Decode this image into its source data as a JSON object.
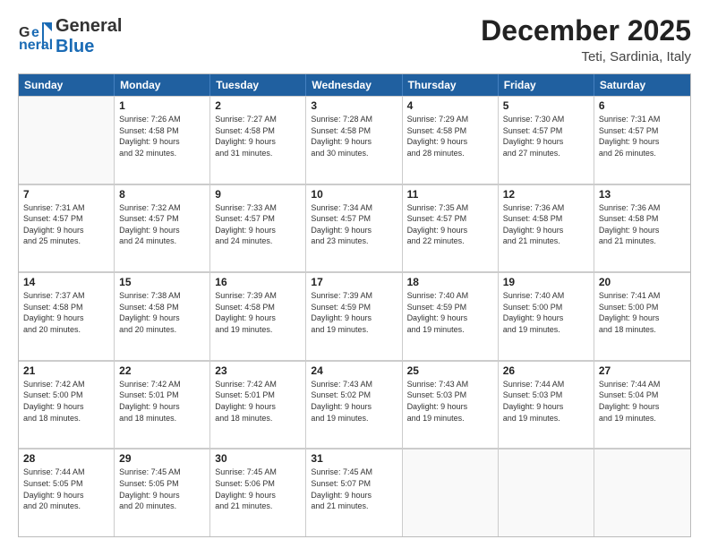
{
  "header": {
    "logo": "GeneralBlue",
    "title": "December 2025",
    "location": "Teti, Sardinia, Italy"
  },
  "days_of_week": [
    "Sunday",
    "Monday",
    "Tuesday",
    "Wednesday",
    "Thursday",
    "Friday",
    "Saturday"
  ],
  "weeks": [
    [
      {
        "day": "",
        "info": ""
      },
      {
        "day": "1",
        "info": "Sunrise: 7:26 AM\nSunset: 4:58 PM\nDaylight: 9 hours\nand 32 minutes."
      },
      {
        "day": "2",
        "info": "Sunrise: 7:27 AM\nSunset: 4:58 PM\nDaylight: 9 hours\nand 31 minutes."
      },
      {
        "day": "3",
        "info": "Sunrise: 7:28 AM\nSunset: 4:58 PM\nDaylight: 9 hours\nand 30 minutes."
      },
      {
        "day": "4",
        "info": "Sunrise: 7:29 AM\nSunset: 4:58 PM\nDaylight: 9 hours\nand 28 minutes."
      },
      {
        "day": "5",
        "info": "Sunrise: 7:30 AM\nSunset: 4:57 PM\nDaylight: 9 hours\nand 27 minutes."
      },
      {
        "day": "6",
        "info": "Sunrise: 7:31 AM\nSunset: 4:57 PM\nDaylight: 9 hours\nand 26 minutes."
      }
    ],
    [
      {
        "day": "7",
        "info": "Sunrise: 7:31 AM\nSunset: 4:57 PM\nDaylight: 9 hours\nand 25 minutes."
      },
      {
        "day": "8",
        "info": "Sunrise: 7:32 AM\nSunset: 4:57 PM\nDaylight: 9 hours\nand 24 minutes."
      },
      {
        "day": "9",
        "info": "Sunrise: 7:33 AM\nSunset: 4:57 PM\nDaylight: 9 hours\nand 24 minutes."
      },
      {
        "day": "10",
        "info": "Sunrise: 7:34 AM\nSunset: 4:57 PM\nDaylight: 9 hours\nand 23 minutes."
      },
      {
        "day": "11",
        "info": "Sunrise: 7:35 AM\nSunset: 4:57 PM\nDaylight: 9 hours\nand 22 minutes."
      },
      {
        "day": "12",
        "info": "Sunrise: 7:36 AM\nSunset: 4:58 PM\nDaylight: 9 hours\nand 21 minutes."
      },
      {
        "day": "13",
        "info": "Sunrise: 7:36 AM\nSunset: 4:58 PM\nDaylight: 9 hours\nand 21 minutes."
      }
    ],
    [
      {
        "day": "14",
        "info": "Sunrise: 7:37 AM\nSunset: 4:58 PM\nDaylight: 9 hours\nand 20 minutes."
      },
      {
        "day": "15",
        "info": "Sunrise: 7:38 AM\nSunset: 4:58 PM\nDaylight: 9 hours\nand 20 minutes."
      },
      {
        "day": "16",
        "info": "Sunrise: 7:39 AM\nSunset: 4:58 PM\nDaylight: 9 hours\nand 19 minutes."
      },
      {
        "day": "17",
        "info": "Sunrise: 7:39 AM\nSunset: 4:59 PM\nDaylight: 9 hours\nand 19 minutes."
      },
      {
        "day": "18",
        "info": "Sunrise: 7:40 AM\nSunset: 4:59 PM\nDaylight: 9 hours\nand 19 minutes."
      },
      {
        "day": "19",
        "info": "Sunrise: 7:40 AM\nSunset: 5:00 PM\nDaylight: 9 hours\nand 19 minutes."
      },
      {
        "day": "20",
        "info": "Sunrise: 7:41 AM\nSunset: 5:00 PM\nDaylight: 9 hours\nand 18 minutes."
      }
    ],
    [
      {
        "day": "21",
        "info": "Sunrise: 7:42 AM\nSunset: 5:00 PM\nDaylight: 9 hours\nand 18 minutes."
      },
      {
        "day": "22",
        "info": "Sunrise: 7:42 AM\nSunset: 5:01 PM\nDaylight: 9 hours\nand 18 minutes."
      },
      {
        "day": "23",
        "info": "Sunrise: 7:42 AM\nSunset: 5:01 PM\nDaylight: 9 hours\nand 18 minutes."
      },
      {
        "day": "24",
        "info": "Sunrise: 7:43 AM\nSunset: 5:02 PM\nDaylight: 9 hours\nand 19 minutes."
      },
      {
        "day": "25",
        "info": "Sunrise: 7:43 AM\nSunset: 5:03 PM\nDaylight: 9 hours\nand 19 minutes."
      },
      {
        "day": "26",
        "info": "Sunrise: 7:44 AM\nSunset: 5:03 PM\nDaylight: 9 hours\nand 19 minutes."
      },
      {
        "day": "27",
        "info": "Sunrise: 7:44 AM\nSunset: 5:04 PM\nDaylight: 9 hours\nand 19 minutes."
      }
    ],
    [
      {
        "day": "28",
        "info": "Sunrise: 7:44 AM\nSunset: 5:05 PM\nDaylight: 9 hours\nand 20 minutes."
      },
      {
        "day": "29",
        "info": "Sunrise: 7:45 AM\nSunset: 5:05 PM\nDaylight: 9 hours\nand 20 minutes."
      },
      {
        "day": "30",
        "info": "Sunrise: 7:45 AM\nSunset: 5:06 PM\nDaylight: 9 hours\nand 21 minutes."
      },
      {
        "day": "31",
        "info": "Sunrise: 7:45 AM\nSunset: 5:07 PM\nDaylight: 9 hours\nand 21 minutes."
      },
      {
        "day": "",
        "info": ""
      },
      {
        "day": "",
        "info": ""
      },
      {
        "day": "",
        "info": ""
      }
    ]
  ]
}
